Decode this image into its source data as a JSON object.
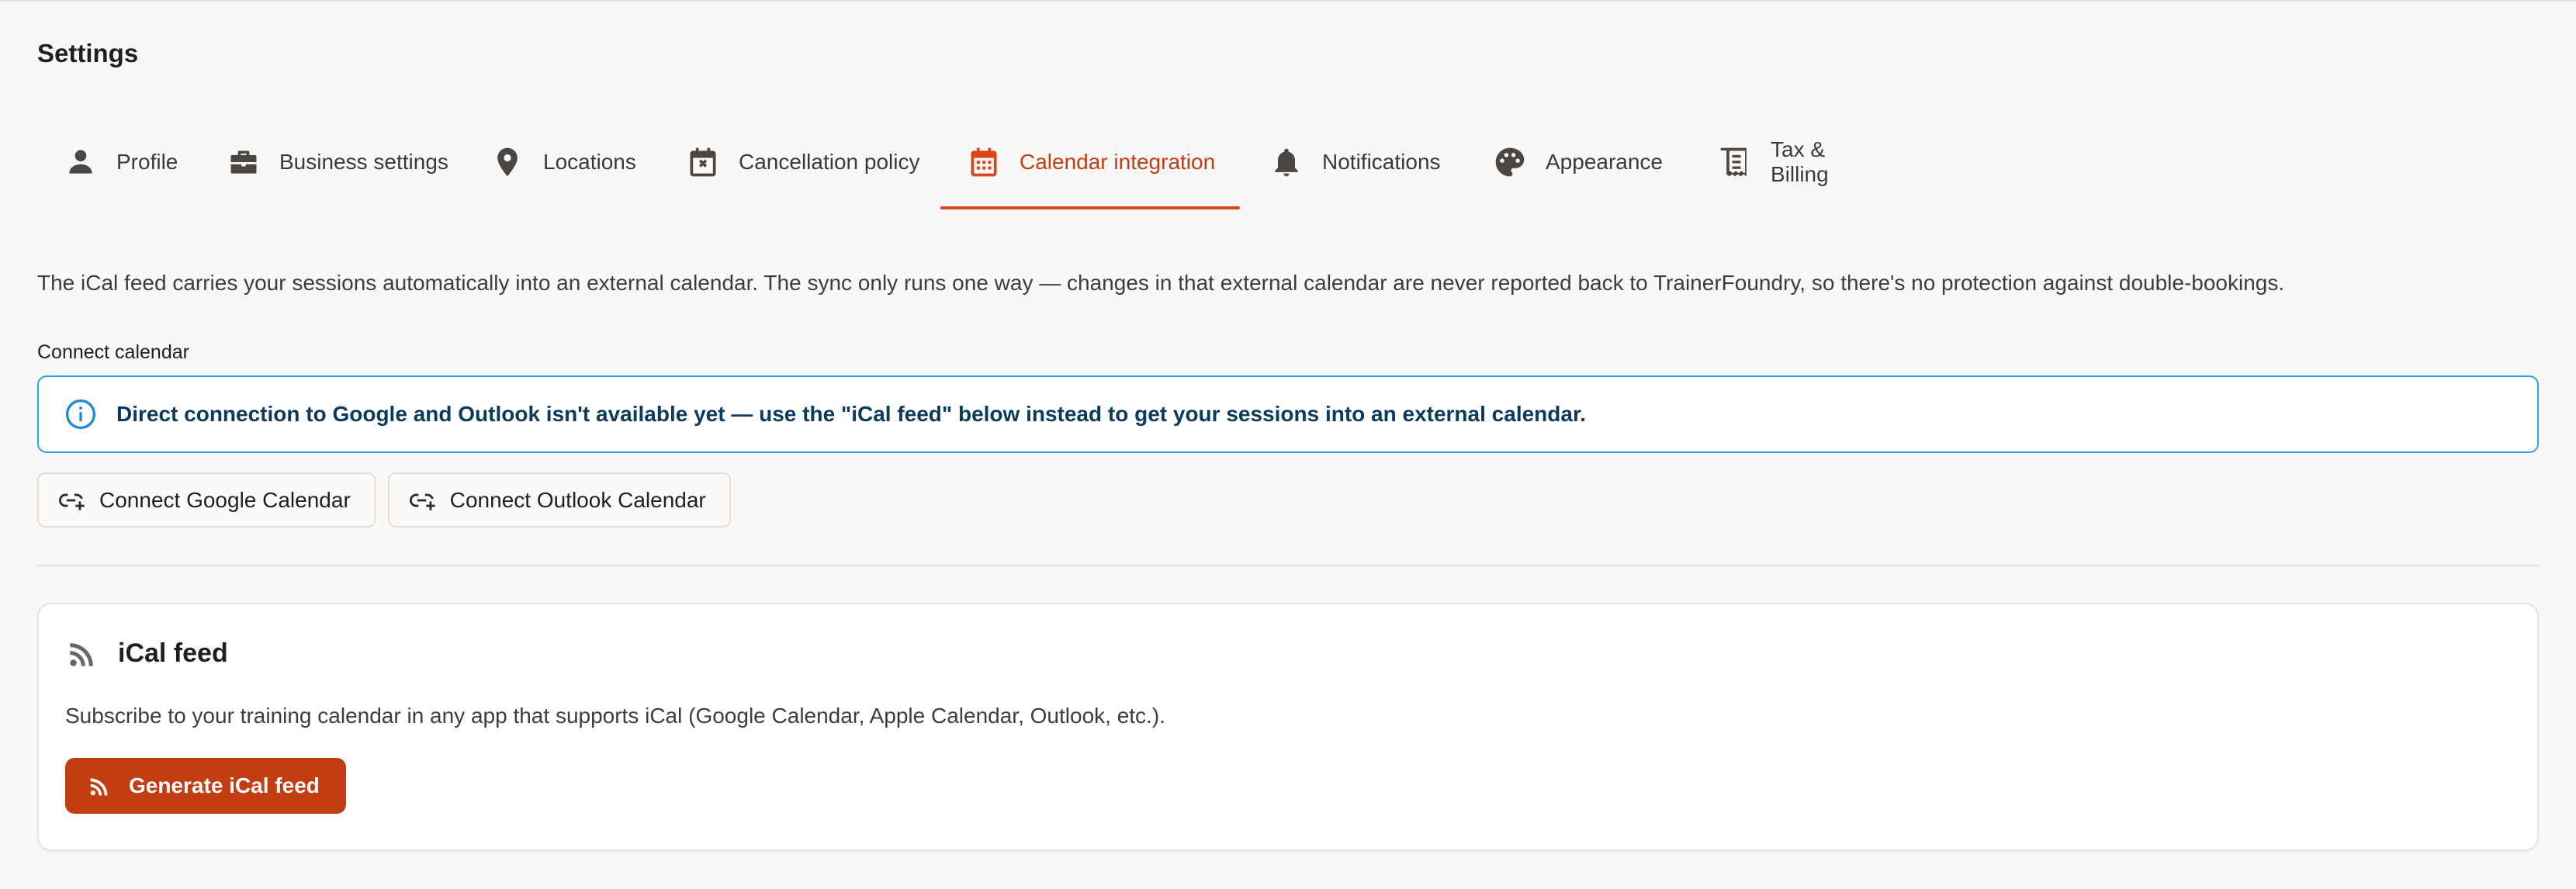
{
  "page": {
    "title": "Settings"
  },
  "tabs": [
    {
      "label": "Profile",
      "icon": "person-icon",
      "active": false
    },
    {
      "label": "Business settings",
      "icon": "briefcase-icon",
      "active": false
    },
    {
      "label": "Locations",
      "icon": "location-pin-icon",
      "active": false
    },
    {
      "label": "Cancellation policy",
      "icon": "calendar-cancel-icon",
      "active": false
    },
    {
      "label": "Calendar integration",
      "icon": "calendar-icon",
      "active": true
    },
    {
      "label": "Notifications",
      "icon": "bell-icon",
      "active": false
    },
    {
      "label": "Appearance",
      "icon": "palette-icon",
      "active": false
    },
    {
      "label": "Tax & Billing",
      "icon": "receipt-icon",
      "active": false
    }
  ],
  "description": "The iCal feed carries your sessions automatically into an external calendar. The sync only runs one way — changes in that external calendar are never reported back to TrainerFoundry, so there's no protection against double-bookings.",
  "connect": {
    "label": "Connect calendar",
    "info": "Direct connection to Google and Outlook isn't available yet — use the \"iCal feed\" below instead to get your sessions into an external calendar.",
    "google_button": "Connect Google Calendar",
    "outlook_button": "Connect Outlook Calendar"
  },
  "ical": {
    "title": "iCal feed",
    "description": "Subscribe to your training calendar in any app that supports iCal (Google Calendar, Apple Calendar, Outlook, etc.).",
    "button": "Generate iCal feed"
  },
  "colors": {
    "accent": "#c23d12",
    "info_border": "#2ba3e0",
    "background": "#f9f8f7"
  }
}
